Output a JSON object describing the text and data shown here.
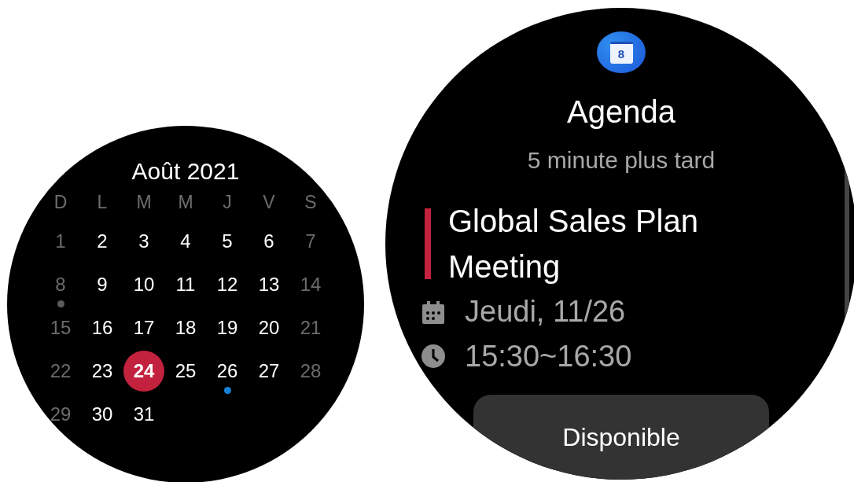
{
  "calendar": {
    "title": "Août 2021",
    "weekdays": [
      {
        "label": "D"
      },
      {
        "label": "L"
      },
      {
        "label": "M"
      },
      {
        "label": "M"
      },
      {
        "label": "J"
      },
      {
        "label": "V"
      },
      {
        "label": "S"
      }
    ],
    "days": [
      {
        "label": "1",
        "muted": true,
        "selected": false
      },
      {
        "label": "2",
        "muted": false,
        "selected": false
      },
      {
        "label": "3",
        "muted": false,
        "selected": false
      },
      {
        "label": "4",
        "muted": false,
        "selected": false
      },
      {
        "label": "5",
        "muted": false,
        "selected": false
      },
      {
        "label": "6",
        "muted": false,
        "selected": false
      },
      {
        "label": "7",
        "muted": true,
        "selected": false
      },
      {
        "label": "8",
        "muted": true,
        "selected": false,
        "color": "#5c5c5c"
      },
      {
        "label": "9",
        "muted": false,
        "selected": false
      },
      {
        "label": "10",
        "muted": false,
        "selected": false
      },
      {
        "label": "11",
        "muted": false,
        "selected": false
      },
      {
        "label": "12",
        "muted": false,
        "selected": false
      },
      {
        "label": "13",
        "muted": false,
        "selected": false
      },
      {
        "label": "14",
        "muted": true,
        "selected": false
      },
      {
        "label": "15",
        "muted": true,
        "selected": false
      },
      {
        "label": "16",
        "muted": false,
        "selected": false
      },
      {
        "label": "17",
        "muted": false,
        "selected": false
      },
      {
        "label": "18",
        "muted": false,
        "selected": false
      },
      {
        "label": "19",
        "muted": false,
        "selected": false
      },
      {
        "label": "20",
        "muted": false,
        "selected": false
      },
      {
        "label": "21",
        "muted": true,
        "selected": false
      },
      {
        "label": "22",
        "muted": true,
        "selected": false
      },
      {
        "label": "23",
        "muted": false,
        "selected": false
      },
      {
        "label": "24",
        "muted": false,
        "selected": true
      },
      {
        "label": "25",
        "muted": false,
        "selected": false
      },
      {
        "label": "26",
        "muted": false,
        "selected": false,
        "color": "#1681d6"
      },
      {
        "label": "27",
        "muted": false,
        "selected": false
      },
      {
        "label": "28",
        "muted": true,
        "selected": false
      },
      {
        "label": "29",
        "muted": true,
        "selected": false
      },
      {
        "label": "30",
        "muted": false,
        "selected": false
      },
      {
        "label": "31",
        "muted": false,
        "selected": false
      }
    ]
  },
  "agenda": {
    "app_badge": "8",
    "title": "Agenda",
    "subtitle": "5 minute plus tard",
    "event": {
      "title": "Global Sales Plan Meeting",
      "color": "#c3223f",
      "details": [
        {
          "kind": "date",
          "text": "Jeudi, 11/26"
        },
        {
          "kind": "time",
          "text": "15:30~16:30"
        }
      ]
    },
    "button": "Disponible"
  }
}
